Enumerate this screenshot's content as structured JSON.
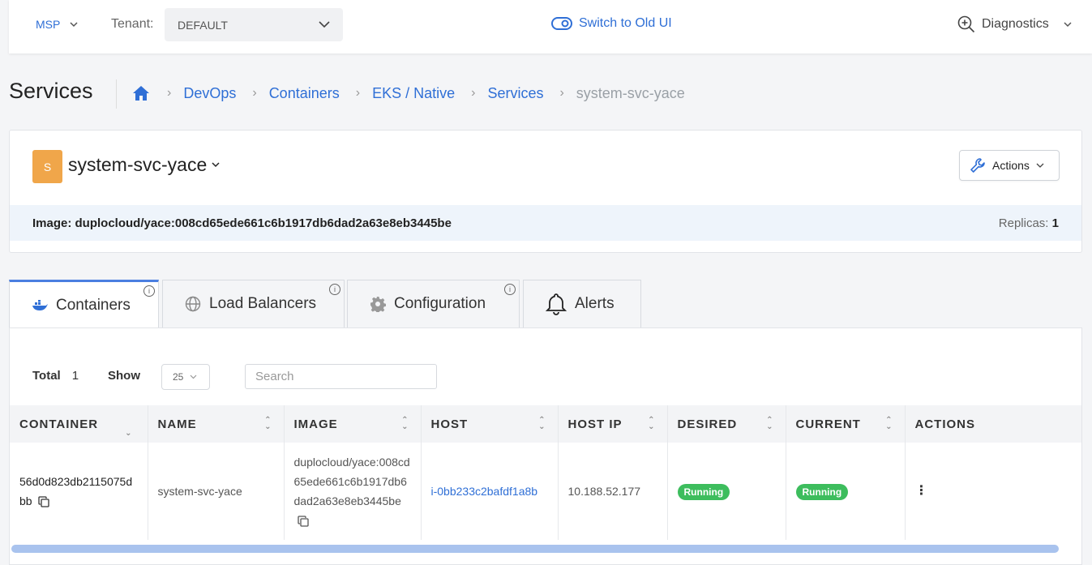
{
  "topbar": {
    "msp_label": "MSP",
    "tenant_label": "Tenant:",
    "tenant_value": "DEFAULT",
    "switch_ui_label": "Switch to Old UI",
    "diagnostics_label": "Diagnostics"
  },
  "page": {
    "title": "Services",
    "breadcrumb": [
      "DevOps",
      "Containers",
      "EKS / Native",
      "Services"
    ],
    "breadcrumb_current": "system-svc-yace"
  },
  "service": {
    "avatar_letter": "S",
    "name": "system-svc-yace",
    "actions_label": "Actions",
    "image_text": "Image: duplocloud/yace:008cd65ede661c6b1917db6dad2a63e8eb3445be",
    "replicas_label": "Replicas:",
    "replicas_value": "1"
  },
  "tabs": [
    {
      "label": "Containers",
      "active": true
    },
    {
      "label": "Load Balancers",
      "active": false
    },
    {
      "label": "Configuration",
      "active": false
    },
    {
      "label": "Alerts",
      "active": false
    }
  ],
  "table_controls": {
    "total_label": "Total",
    "total_value": "1",
    "show_label": "Show",
    "show_value": "25",
    "search_placeholder": "Search"
  },
  "table": {
    "headers": [
      "CONTAINER",
      "NAME",
      "IMAGE",
      "HOST",
      "HOST IP",
      "DESIRED",
      "CURRENT",
      "ACTIONS"
    ],
    "rows": [
      {
        "container": "56d0d823db2115075dbb",
        "name": "system-svc-yace",
        "image": "duplocloud/yace:008cd65ede661c6b1917db6dad2a63e8eb3445be",
        "host": "i-0bb233c2bafdf1a8b",
        "host_ip": "10.188.52.177",
        "desired": "Running",
        "current": "Running",
        "actions": "⋮"
      }
    ]
  },
  "colors": {
    "accent": "#2f6fd6",
    "avatar": "#f0a64a",
    "running": "#3dbd5d"
  }
}
